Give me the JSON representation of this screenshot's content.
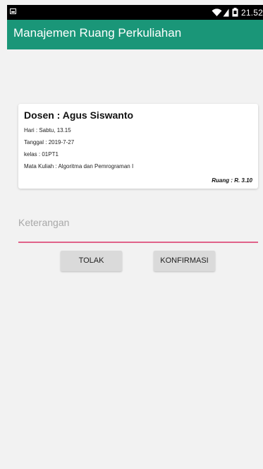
{
  "status_bar": {
    "time": "21.52",
    "icons": [
      "notification-icon",
      "wifi-icon",
      "signal-icon",
      "battery-icon"
    ]
  },
  "app_bar": {
    "title": "Manajemen Ruang Perkuliahan",
    "color": "#1a9678"
  },
  "card": {
    "dosen": "Dosen : Agus Siswanto",
    "hari": "Hari : Sabtu, 13.15",
    "tanggal": "Tanggal : 2019-7-27",
    "kelas": "kelas : 01PT1",
    "mata_kuliah": "Mata Kuliah : Algoritma dan Pemrograman I",
    "ruang": "Ruang : R. 3.10"
  },
  "form": {
    "keterangan_placeholder": "Keterangan",
    "keterangan_value": "",
    "underline_color": "#e0628a"
  },
  "buttons": {
    "tolak": "TOLAK",
    "konfirmasi": "KONFIRMASI"
  }
}
